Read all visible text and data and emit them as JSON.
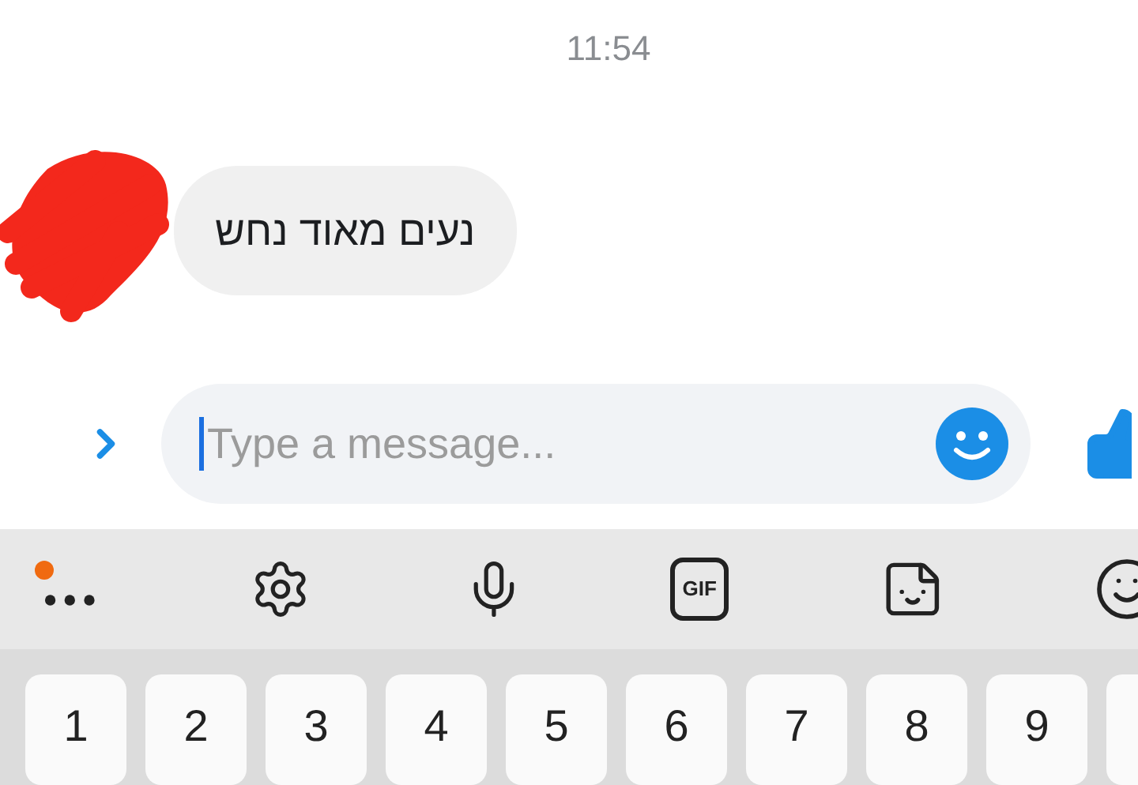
{
  "chat": {
    "time": "11:54",
    "messages": [
      {
        "text": "נעים מאוד נחש"
      }
    ]
  },
  "composer": {
    "placeholder": "Type a message..."
  },
  "keyboard_toolbar": {
    "more_badge": true,
    "gif_label": "GIF"
  },
  "keyboard": {
    "number_keys": [
      "1",
      "2",
      "3",
      "4",
      "5",
      "6",
      "7",
      "8",
      "9"
    ]
  }
}
